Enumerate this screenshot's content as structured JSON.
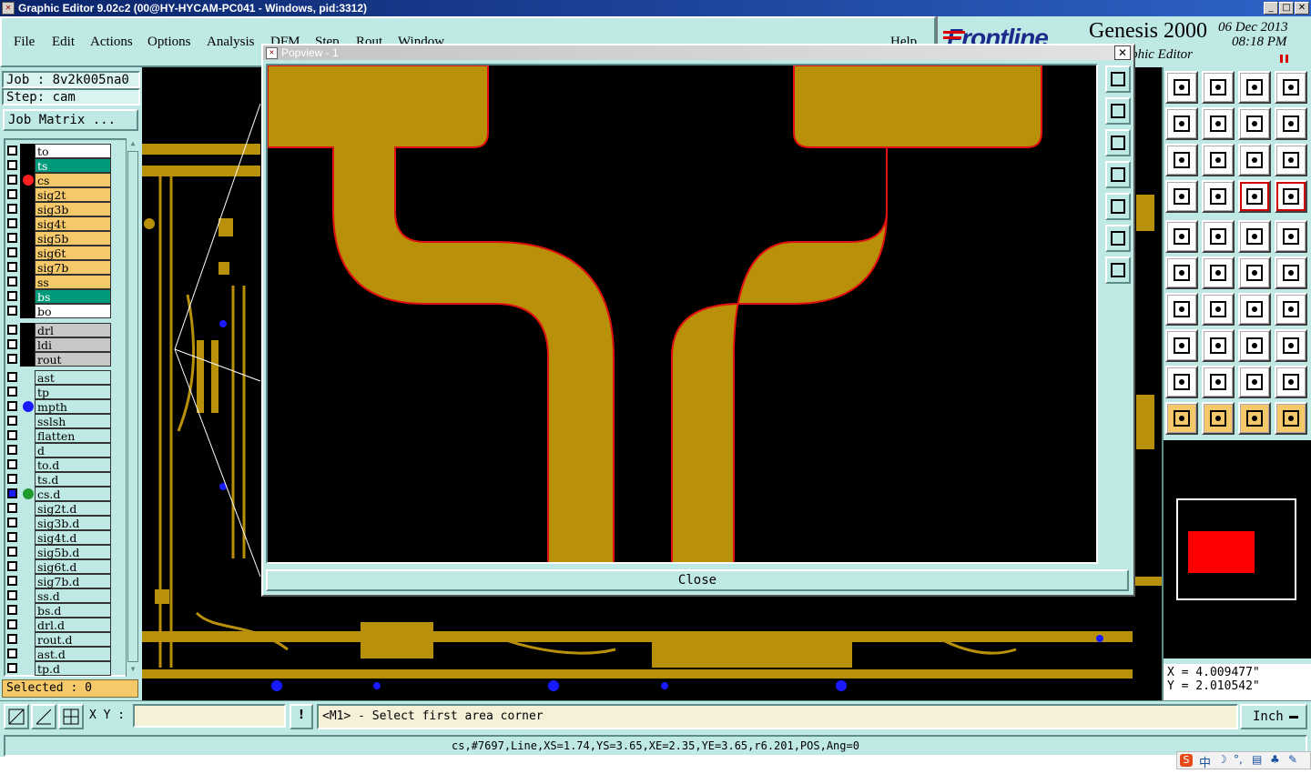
{
  "window": {
    "title": "Graphic Editor 9.02c2 (00@HY-HYCAM-PC041 - Windows, pid:3312)",
    "btn_min": "_",
    "btn_max": "□",
    "btn_close": "✕"
  },
  "menu": [
    "File",
    "Edit",
    "Actions",
    "Options",
    "Analysis",
    "DFM",
    "Step",
    "Rout",
    "Window",
    "Help"
  ],
  "brand": {
    "logo": "Frontline",
    "product": "Genesis 2000",
    "date": "06 Dec 2013",
    "time": "08:18 PM",
    "subtitle": "Graphic Editor"
  },
  "job": {
    "job_label": "Job : 8v2k005na0",
    "step_label": "Step: cam",
    "matrix_button": "Job Matrix ..."
  },
  "layers": [
    {
      "name": "to",
      "bg": "#ffffff",
      "dot": ""
    },
    {
      "name": "ts",
      "bg": "#009b7a",
      "dot": ""
    },
    {
      "name": "cs",
      "bg": "#f5c86a",
      "dot": "#ff2020"
    },
    {
      "name": "sig2t",
      "bg": "#f5c86a",
      "dot": ""
    },
    {
      "name": "sig3b",
      "bg": "#f5c86a",
      "dot": ""
    },
    {
      "name": "sig4t",
      "bg": "#f5c86a",
      "dot": ""
    },
    {
      "name": "sig5b",
      "bg": "#f5c86a",
      "dot": ""
    },
    {
      "name": "sig6t",
      "bg": "#f5c86a",
      "dot": ""
    },
    {
      "name": "sig7b",
      "bg": "#f5c86a",
      "dot": ""
    },
    {
      "name": "ss",
      "bg": "#f5c86a",
      "dot": ""
    },
    {
      "name": "bs",
      "bg": "#009b7a",
      "dot": ""
    },
    {
      "name": "bo",
      "bg": "#ffffff",
      "dot": ""
    },
    {
      "name": "drl",
      "bg": "#c8c8c8",
      "dot": ""
    },
    {
      "name": "ldi",
      "bg": "#c8c8c8",
      "dot": ""
    },
    {
      "name": "rout",
      "bg": "#c8c8c8",
      "dot": ""
    },
    {
      "name": "ast",
      "bg": "#bfe9e5",
      "dot": ""
    },
    {
      "name": "tp",
      "bg": "#bfe9e5",
      "dot": ""
    },
    {
      "name": "mpth",
      "bg": "#bfe9e5",
      "dot": "#1a1aff"
    },
    {
      "name": "sslsh",
      "bg": "#bfe9e5",
      "dot": ""
    },
    {
      "name": "flatten",
      "bg": "#bfe9e5",
      "dot": ""
    },
    {
      "name": "d",
      "bg": "#bfe9e5",
      "dot": ""
    },
    {
      "name": "to.d",
      "bg": "#bfe9e5",
      "dot": ""
    },
    {
      "name": "ts.d",
      "bg": "#bfe9e5",
      "dot": ""
    },
    {
      "name": "cs.d",
      "bg": "#bfe9e5",
      "dot": "#1f9a2c"
    },
    {
      "name": "sig2t.d",
      "bg": "#bfe9e5",
      "dot": ""
    },
    {
      "name": "sig3b.d",
      "bg": "#bfe9e5",
      "dot": ""
    },
    {
      "name": "sig4t.d",
      "bg": "#bfe9e5",
      "dot": ""
    },
    {
      "name": "sig5b.d",
      "bg": "#bfe9e5",
      "dot": ""
    },
    {
      "name": "sig6t.d",
      "bg": "#bfe9e5",
      "dot": ""
    },
    {
      "name": "sig7b.d",
      "bg": "#bfe9e5",
      "dot": ""
    },
    {
      "name": "ss.d",
      "bg": "#bfe9e5",
      "dot": ""
    },
    {
      "name": "bs.d",
      "bg": "#bfe9e5",
      "dot": ""
    },
    {
      "name": "drl.d",
      "bg": "#bfe9e5",
      "dot": ""
    },
    {
      "name": "rout.d",
      "bg": "#bfe9e5",
      "dot": ""
    },
    {
      "name": "ast.d",
      "bg": "#bfe9e5",
      "dot": ""
    },
    {
      "name": "tp.d",
      "bg": "#bfe9e5",
      "dot": ""
    }
  ],
  "selected": "Selected : 0",
  "popup": {
    "title": "Popview - 1",
    "close_label": "Close",
    "close_x": "✕"
  },
  "coords": {
    "x": "X = 4.009477\"",
    "y": "Y = 2.010542\""
  },
  "statusbar": {
    "xy_label": "X Y :",
    "xy_value": "",
    "message": "<M1> - Select first area corner",
    "units": "Inch",
    "info": "cs,#7697,Line,XS=1.74,YS=3.65,XE=2.35,YE=3.65,r6.201,POS,Ang=0"
  },
  "colors": {
    "copper": "#b8900a",
    "board": "#000000",
    "panel": "#bfe9e5",
    "outline": "#e01010"
  }
}
